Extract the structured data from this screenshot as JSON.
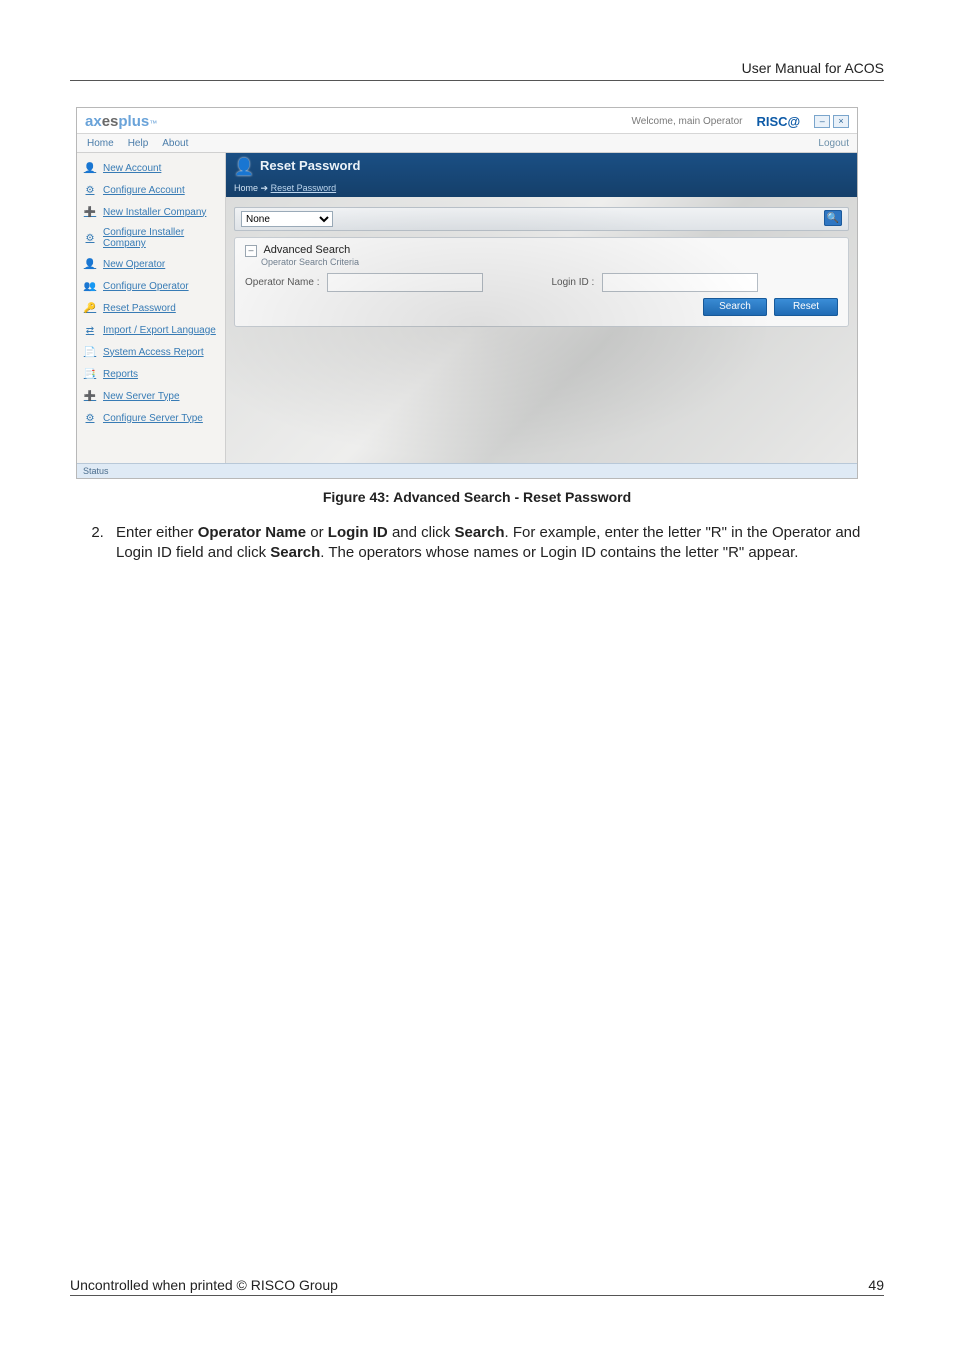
{
  "doc": {
    "header_right": "User Manual for ACOS",
    "footer_left": "Uncontrolled when printed © RISCO Group",
    "footer_right": "49"
  },
  "caption": "Figure 43: Advanced Search - Reset Password",
  "step": {
    "num": "2.",
    "pre": "Enter either ",
    "b1": "Operator Name",
    "mid1": " or ",
    "b2": "Login ID",
    "mid2": " and click ",
    "b3": "Search",
    "post1": ". For example, enter the letter \"R\" in the Operator and Login ID field and click ",
    "b4": "Search",
    "post2": ". The operators whose names or Login ID contains the letter \"R\" appear."
  },
  "app": {
    "brand_ax": "ax",
    "brand_es": "es",
    "brand_plus": "plus",
    "brand_tm": "™",
    "welcome": "Welcome, main Operator",
    "risc": "RISC@",
    "win_min": "–",
    "win_close": "×",
    "menu": {
      "home": "Home",
      "help": "Help",
      "about": "About",
      "logout": "Logout"
    },
    "sidebar": {
      "items": [
        {
          "label": "New Account"
        },
        {
          "label": "Configure Account"
        },
        {
          "label": "New Installer Company"
        },
        {
          "label": "Configure Installer Company"
        },
        {
          "label": "New Operator"
        },
        {
          "label": "Configure Operator"
        },
        {
          "label": "Reset Password"
        },
        {
          "label": "Import / Export Language"
        },
        {
          "label": "System Access Report"
        },
        {
          "label": "Reports"
        },
        {
          "label": "New Server Type"
        },
        {
          "label": "Configure Server Type"
        }
      ]
    },
    "title": "Reset Password",
    "crumb_home": "Home",
    "crumb_sep": "  ➔  ",
    "crumb_current": "Reset Password",
    "filter_selected": "None",
    "go_icon": "🔍",
    "adv_legend": "Advanced Search",
    "adv_sub": "Operator Search Criteria",
    "op_name_label": "Operator Name :",
    "login_id_label": "Login ID :",
    "btn_search": "Search",
    "btn_reset": "Reset",
    "status": "Status"
  }
}
